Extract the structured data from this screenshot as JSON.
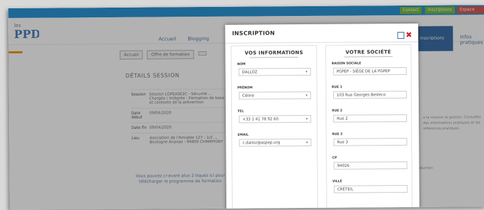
{
  "topbar": {
    "b1": "Contact",
    "b2": "Inscriptions",
    "b3": "Espace cients"
  },
  "nav": {
    "item1": "Accueil",
    "item2": "Blogging",
    "item3": "Inscriptions",
    "item4": "Infos pratiques"
  },
  "breadcrumb": [
    "Accueil",
    "Offre de formation",
    ""
  ],
  "section_title": "DÉTAILS SESSION",
  "details": [
    {
      "k": "Session",
      "v": "Session LGPEASE2C - Sécurité ... Chargée / intégrée : Formation de base et contexte de la prévention"
    },
    {
      "k": "Date début",
      "v": "09/04/2020"
    },
    {
      "k": "Date fin",
      "v": "09/04/2020"
    },
    {
      "k": "Lieu",
      "v": "Asociation de l'Amiable 127 - 1/2 ... Boulogne Ananas - 94800 CHAMPIGNY"
    }
  ],
  "note": "Vous pouvez ci-avant plus 2 tiquez ici pour télécharger le programme de formation",
  "right_text": "a la mission la gestion. Consultez des informations pratiques et les références pratiques",
  "right_text2": "réduction",
  "modal": {
    "title": "INSCRIPTION",
    "left_title": "VOS INFORMATIONS",
    "right_title": "VOTRE SOCIÉTÉ",
    "fields_left": [
      {
        "label": "NOM",
        "value": "DALLOZ"
      },
      {
        "label": "PRÉNOM",
        "value": "Céline"
      },
      {
        "label": "TEL",
        "value": "+33 1 41 78 92 60"
      },
      {
        "label": "EMAIL",
        "value": "c.dalloz@aspep.org"
      }
    ],
    "fields_right": [
      {
        "label": "RAISON SOCIALE",
        "value": "PGPEP - SIÈGE DE LA PGPEP"
      },
      {
        "label": "RUE 1",
        "value": "103 Rue Georges Besleco"
      },
      {
        "label": "RUE 2",
        "value": "Rue 2"
      },
      {
        "label": "RUE 3",
        "value": "Rue 3"
      },
      {
        "label": "CP",
        "value": "94026"
      },
      {
        "label": "VILLE",
        "value": "CRÉTEIL"
      }
    ]
  },
  "colors": {
    "accent": "#2c96d6",
    "nav_active": "#3b6fa6",
    "close": "#d0232a",
    "orange": "#f29a1d"
  },
  "icons": {
    "logo": "ppd-logo",
    "restore": "square-icon",
    "close": "close-icon"
  }
}
